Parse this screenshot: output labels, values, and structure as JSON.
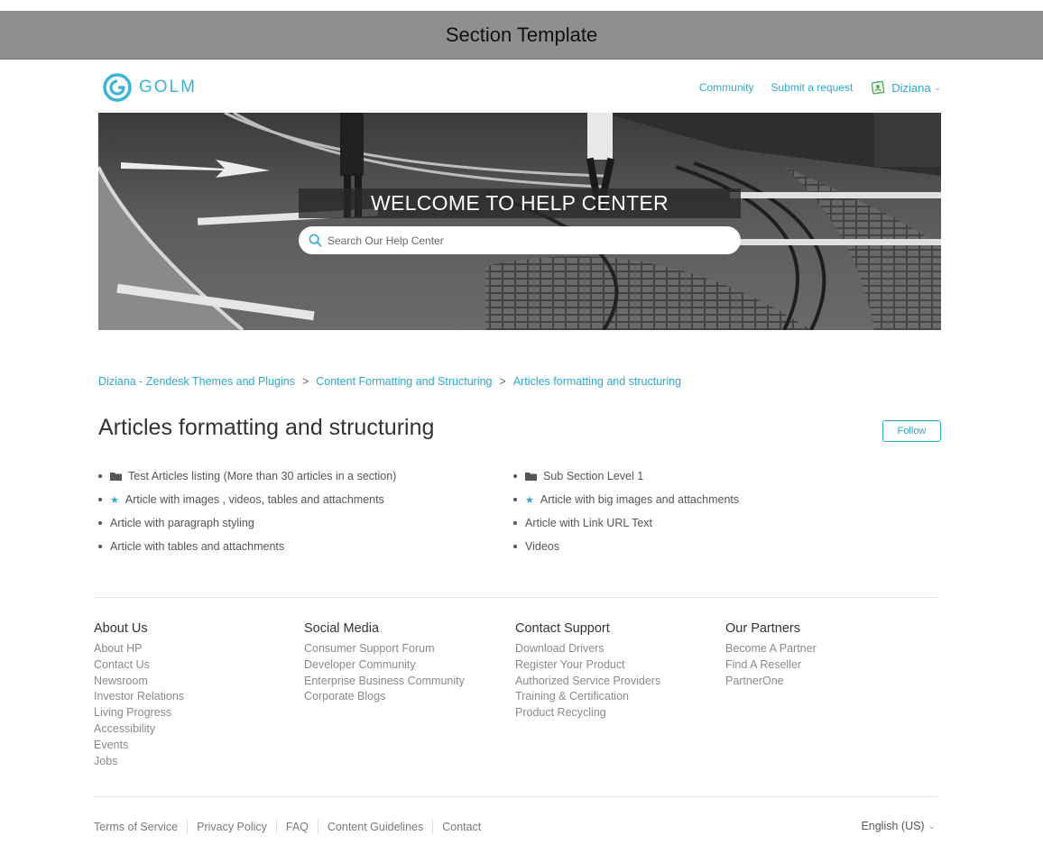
{
  "topbar": {
    "title": "Section Template"
  },
  "header": {
    "logo_text": "GOLM",
    "nav": {
      "community": "Community",
      "submit_request": "Submit a request"
    },
    "user": {
      "name": "Diziana",
      "caret": "⌄"
    }
  },
  "hero": {
    "title": "WELCOME TO HELP CENTER",
    "search_placeholder": "Search Our Help Center"
  },
  "breadcrumb": {
    "items": [
      "Diziana - Zendesk Themes and Plugins",
      "Content Formatting and Structuring",
      "Articles formatting and structuring"
    ],
    "separator": ">"
  },
  "section": {
    "title": "Articles formatting and structuring",
    "follow_label": "Follow"
  },
  "articles": {
    "left": [
      {
        "label": "Test Articles listing (More than 30 articles in a section)",
        "icon": "folder-icon"
      },
      {
        "label": "Article with images , videos, tables and attachments",
        "icon": "star-icon"
      },
      {
        "label": "Article with paragraph styling",
        "icon": ""
      },
      {
        "label": "Article with tables and attachments",
        "icon": ""
      }
    ],
    "right": [
      {
        "label": "Sub Section Level 1",
        "icon": "folder-icon"
      },
      {
        "label": "Article with big images and attachments",
        "icon": "star-icon"
      },
      {
        "label": "Article with Link URL Text",
        "icon": ""
      },
      {
        "label": "Videos",
        "icon": ""
      }
    ]
  },
  "footer": {
    "columns": [
      {
        "title": "About Us",
        "links": [
          "About HP",
          "Contact Us",
          "Newsroom",
          "Investor Relations",
          "Living Progress",
          "Accessibility",
          "Events",
          "Jobs"
        ]
      },
      {
        "title": "Social Media",
        "links": [
          "Consumer Support Forum",
          "Developer Community",
          "Enterprise Business Community",
          "Corporate Blogs"
        ]
      },
      {
        "title": "Contact Support",
        "links": [
          "Download Drivers",
          "Register Your Product",
          "Authorized Service Providers",
          "Training & Certification",
          "Product Recycling"
        ]
      },
      {
        "title": "Our Partners",
        "links": [
          "Become A Partner",
          "Find A Reseller",
          "PartnerOne"
        ]
      }
    ],
    "legal": [
      "Terms of Service",
      "Privacy Policy",
      "FAQ",
      "Content Guidelines",
      "Contact"
    ],
    "language": "English (US)",
    "language_caret": "⌄"
  },
  "colors": {
    "accent": "#2fa7d3",
    "topbar": "#8f8f8f"
  }
}
